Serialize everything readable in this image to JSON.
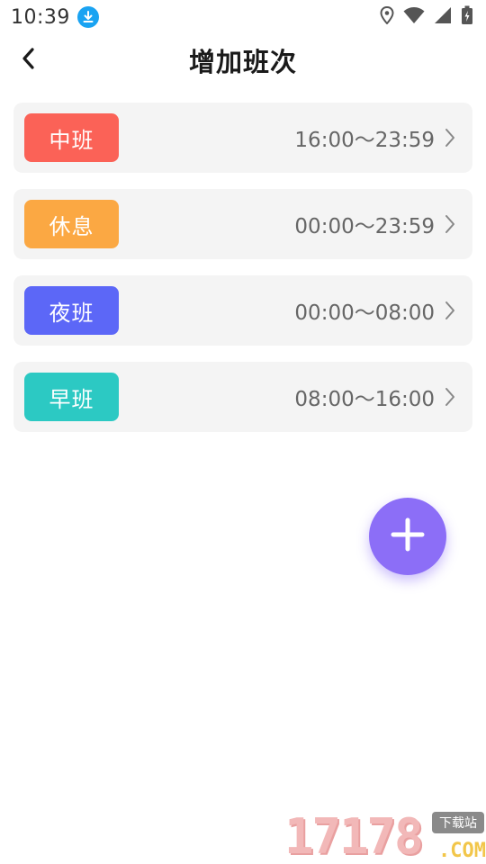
{
  "status_bar": {
    "time": "10:39",
    "icons": [
      "download-icon",
      "location-icon",
      "wifi-icon",
      "signal-icon",
      "battery-icon"
    ]
  },
  "header": {
    "title": "增加班次",
    "back_icon": "chevron-left-icon"
  },
  "shifts": [
    {
      "name": "中班",
      "time": "16:00～23:59",
      "color": "#fb6257"
    },
    {
      "name": "休息",
      "time": "00:00～23:59",
      "color": "#fba843"
    },
    {
      "name": "夜班",
      "time": "00:00～08:00",
      "color": "#5c67f7"
    },
    {
      "name": "早班",
      "time": "08:00～16:00",
      "color": "#2cc9c3"
    }
  ],
  "fab": {
    "icon": "plus-icon",
    "color": "#8c6ef7"
  },
  "watermark": {
    "number": "17178",
    "tag": "下载站",
    "suffix": ".COM"
  }
}
